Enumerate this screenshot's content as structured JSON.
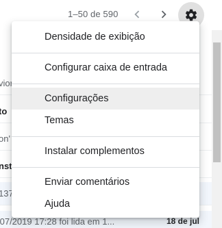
{
  "toolbar": {
    "pagination": "1–50 de 590",
    "prev_icon": "chevron-left-icon",
    "next_icon": "chevron-right-icon",
    "settings_icon": "gear-icon"
  },
  "inbox_rows": [
    {
      "text": "vior",
      "style": "normal"
    },
    {
      "text": "to",
      "style": "bold"
    },
    {
      "text": "on'",
      "style": "normal"
    },
    {
      "text": "nst",
      "style": "bold"
    },
    {
      "text": "137",
      "style": "normal"
    }
  ],
  "bottom_row": {
    "snippet": "/07/2019 17:28 foi lida em 1...",
    "date": "18 de jul"
  },
  "settings_menu": {
    "items": [
      {
        "label": "Densidade de exibição"
      },
      {
        "label": "Configurar caixa de entrada"
      },
      {
        "label": "Configurações"
      },
      {
        "label": "Temas"
      },
      {
        "label": "Instalar complementos"
      },
      {
        "label": "Enviar comentários"
      },
      {
        "label": "Ajuda"
      }
    ],
    "highlighted_item": "Configurações"
  },
  "colors": {
    "menu_background": "#ffffff",
    "menu_highlight": "#eeeeee",
    "separator": "#dadce0",
    "gear_button_active": "#e0e0e0",
    "secondary_text": "#5f6368",
    "primary_text": "#202124"
  }
}
